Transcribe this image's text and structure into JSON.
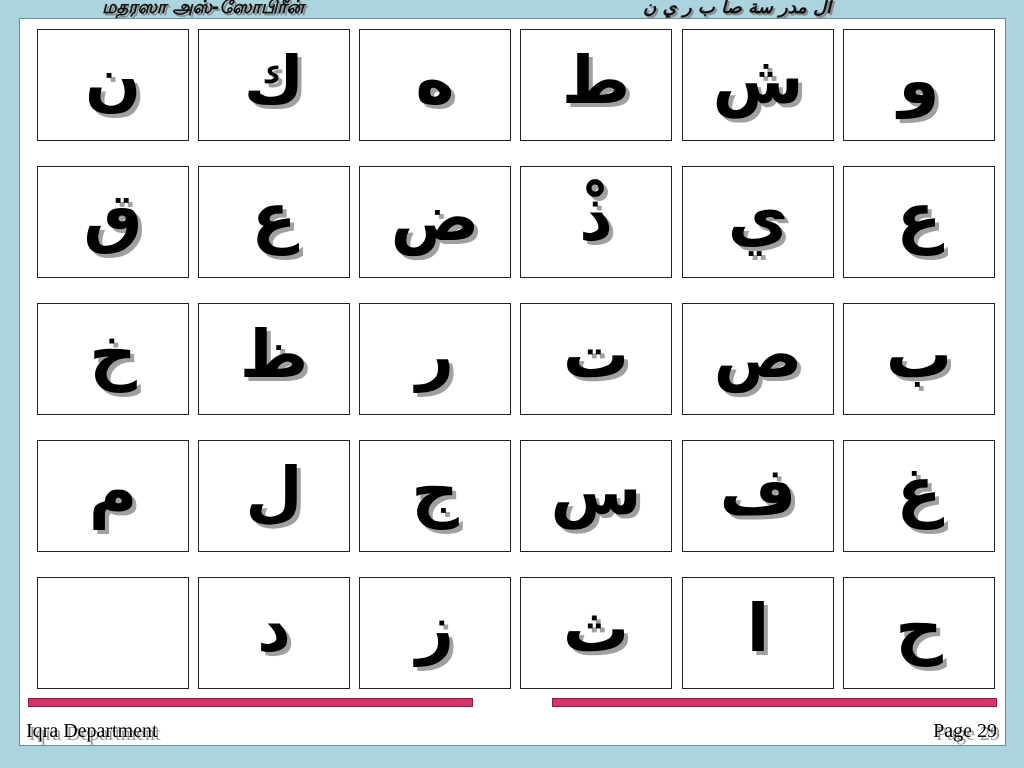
{
  "header": {
    "left_title": "மதரஸா அஸ்-ஸோபிரீன்",
    "right_title": "ال مدر سة صا ب ر ي ن"
  },
  "grid": {
    "rows": [
      [
        "ن",
        "ك",
        "ه",
        "ط",
        "ش",
        "و"
      ],
      [
        "ق",
        "ع",
        "ض",
        "ذْ",
        "ي",
        "ع"
      ],
      [
        "خ",
        "ظ",
        "ر",
        "ت",
        "ص",
        "ب"
      ],
      [
        "م",
        "ل",
        "ج",
        "س",
        "ف",
        "غ"
      ],
      [
        "",
        "د",
        "ز",
        "ث",
        "ا",
        "ح"
      ]
    ]
  },
  "footer": {
    "left": "Iqra Department",
    "right": "Page 29"
  },
  "colors": {
    "background": "#abd4df",
    "divider": "#d6336c",
    "panel": "#ffffff"
  }
}
